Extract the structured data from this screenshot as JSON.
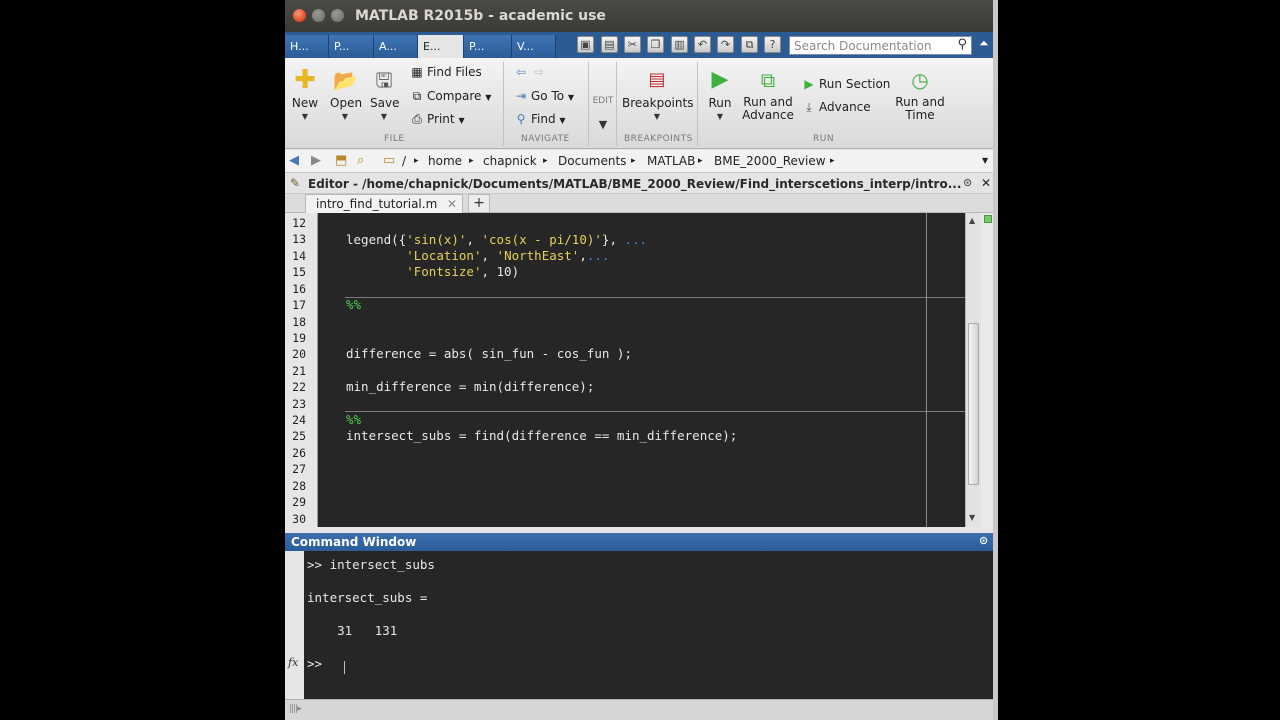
{
  "window": {
    "title": "MATLAB R2015b - academic use"
  },
  "tabs": [
    {
      "label": "H..."
    },
    {
      "label": "P..."
    },
    {
      "label": "A..."
    },
    {
      "label": "E..."
    },
    {
      "label": "P..."
    },
    {
      "label": "V..."
    }
  ],
  "search": {
    "placeholder": "Search Documentation"
  },
  "ribbon": {
    "file": {
      "new": "New",
      "open": "Open",
      "save": "Save",
      "find_files": "Find Files",
      "compare": "Compare",
      "print": "Print",
      "section": "FILE"
    },
    "navigate": {
      "goto": "Go To",
      "find": "Find",
      "section": "NAVIGATE"
    },
    "edit": {
      "label": "EDIT"
    },
    "breakpoints": {
      "label": "Breakpoints",
      "section": "BREAKPOINTS"
    },
    "run": {
      "run": "Run",
      "run_advance_1": "Run and",
      "run_advance_2": "Advance",
      "run_section": "Run Section",
      "advance": "Advance",
      "run_time_1": "Run and",
      "run_time_2": "Time",
      "section": "RUN"
    }
  },
  "address": {
    "root": "/",
    "crumbs": [
      "home",
      "chapnick",
      "Documents",
      "MATLAB",
      "BME_2000_Review"
    ]
  },
  "editor": {
    "header": "Editor - /home/chapnick/Documents/MATLAB/BME_2000_Review/Find_interscetions_interp/intro...",
    "tab": "intro_find_tutorial.m",
    "line_numbers": [
      "12",
      "13",
      "14",
      "15",
      "16",
      "17",
      "18",
      "19",
      "20",
      "21",
      "22",
      "23",
      "24",
      "25",
      "26",
      "27",
      "28",
      "29",
      "30"
    ],
    "lines": {
      "l13_a": "legend({",
      "l13_s1": "'sin(x)'",
      "l13_b": ", ",
      "l13_s2": "'cos(x - pi/10)'",
      "l13_c": "}, ",
      "l13_d": "...",
      "l14_s": "'Location'",
      "l14_b": ", ",
      "l14_s2": "'NorthEast'",
      "l14_c": ",",
      "l14_d": "...",
      "l15_s": "'Fontsize'",
      "l15_b": ", 10)",
      "l17": "%%",
      "l20": "difference = abs( sin_fun - cos_fun );",
      "l22": "min_difference = min(difference);",
      "l24": "%%",
      "l25": "intersect_subs = find(difference == min_difference);"
    }
  },
  "command_window": {
    "title": "Command Window",
    "line1": ">> intersect_subs",
    "line2": "intersect_subs =",
    "line3": "    31   131",
    "prompt": ">>",
    "fx": "fx"
  }
}
